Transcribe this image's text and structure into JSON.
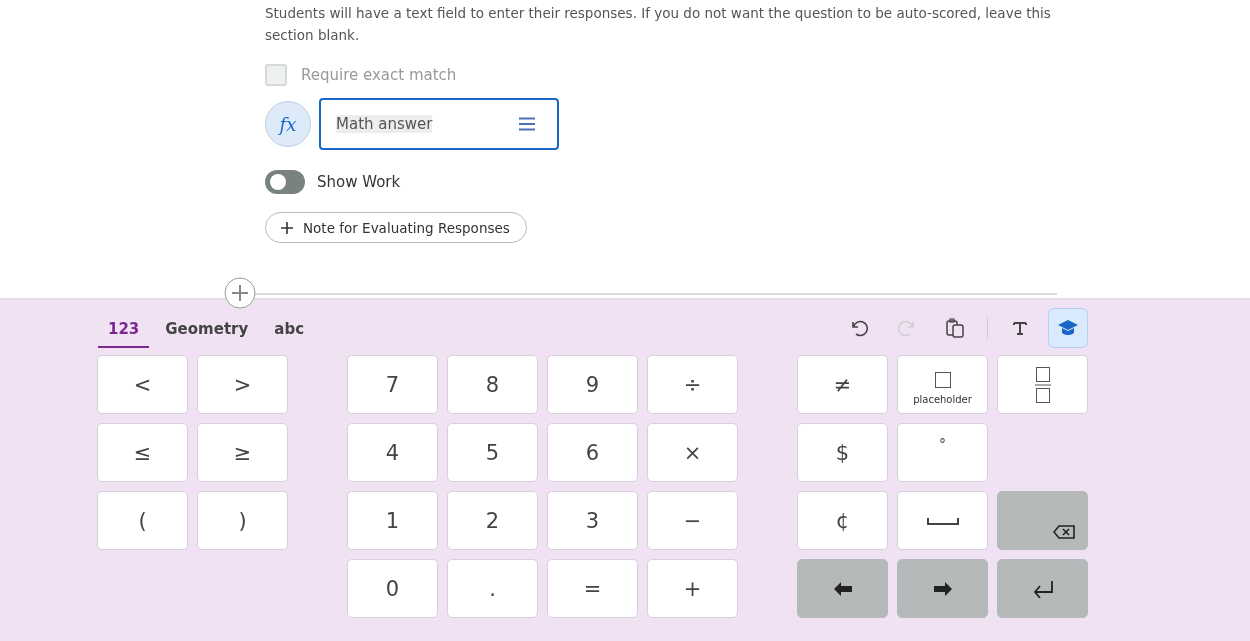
{
  "instructions": "Students will have a text field to enter their responses. If you do not want the question to be auto-scored, leave this section blank.",
  "exact_match": {
    "label": "Require exact match",
    "checked": false
  },
  "formula_button": {
    "label": "fx"
  },
  "math_field": {
    "placeholder": "Math answer"
  },
  "show_work": {
    "label": "Show Work",
    "on": false
  },
  "note_button": {
    "label": "Note for Evaluating Responses"
  },
  "keyboard": {
    "tabs": [
      {
        "label": "123",
        "selected": true
      },
      {
        "label": "Geometry",
        "selected": false
      },
      {
        "label": "abc",
        "selected": false
      }
    ],
    "toolbar": [
      {
        "kind": "undo",
        "disabled": false,
        "selected": false
      },
      {
        "kind": "redo",
        "disabled": true,
        "selected": false
      },
      {
        "kind": "paste",
        "disabled": false,
        "selected": false
      },
      {
        "kind": "text",
        "disabled": false,
        "selected": false
      },
      {
        "kind": "learn",
        "disabled": false,
        "selected": true
      }
    ],
    "groups": [
      {
        "rows": [
          [
            {
              "kind": "char",
              "label": "<"
            },
            {
              "kind": "char",
              "label": ">"
            }
          ],
          [
            {
              "kind": "char",
              "label": "≤"
            },
            {
              "kind": "char",
              "label": "≥"
            }
          ],
          [
            {
              "kind": "char",
              "label": "("
            },
            {
              "kind": "char",
              "label": ")"
            }
          ]
        ]
      },
      {
        "rows": [
          [
            {
              "kind": "char",
              "label": "7"
            },
            {
              "kind": "char",
              "label": "8"
            },
            {
              "kind": "char",
              "label": "9"
            },
            {
              "kind": "char",
              "label": "÷"
            }
          ],
          [
            {
              "kind": "char",
              "label": "4"
            },
            {
              "kind": "char",
              "label": "5"
            },
            {
              "kind": "char",
              "label": "6"
            },
            {
              "kind": "char",
              "label": "×"
            }
          ],
          [
            {
              "kind": "char",
              "label": "1"
            },
            {
              "kind": "char",
              "label": "2"
            },
            {
              "kind": "char",
              "label": "3"
            },
            {
              "kind": "char",
              "label": "−"
            }
          ],
          [
            {
              "kind": "char",
              "label": "0"
            },
            {
              "kind": "char",
              "label": "."
            },
            {
              "kind": "char",
              "label": "="
            },
            {
              "kind": "char",
              "label": "+"
            }
          ]
        ]
      },
      {
        "rows": [
          [
            {
              "kind": "char",
              "label": "≠"
            },
            {
              "kind": "placeholder",
              "label": "placeholder"
            },
            {
              "kind": "fraction"
            }
          ],
          [
            {
              "kind": "char",
              "label": "$"
            },
            {
              "kind": "degree",
              "label": "°"
            }
          ],
          [
            {
              "kind": "char",
              "label": "¢"
            },
            {
              "kind": "space"
            },
            {
              "kind": "backspace"
            }
          ],
          [
            {
              "kind": "left"
            },
            {
              "kind": "right"
            },
            {
              "kind": "enter"
            }
          ]
        ]
      }
    ]
  }
}
